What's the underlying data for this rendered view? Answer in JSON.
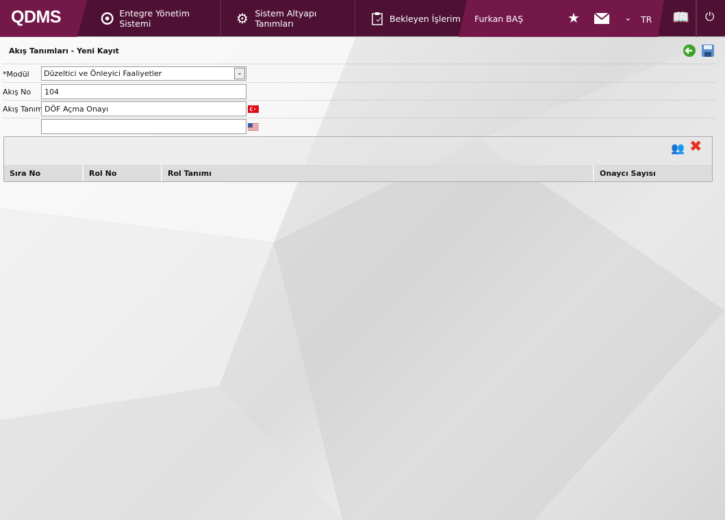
{
  "header": {
    "logo": "QDMS",
    "nav": [
      {
        "label": "Entegre Yönetim Sistemi",
        "icon": "q-icon"
      },
      {
        "label": "Sistem Altyapı Tanımları",
        "icon": "gear-icon"
      },
      {
        "label": "Bekleyen İşlerim",
        "icon": "clipboard-icon"
      }
    ],
    "user": "Furkan BAŞ",
    "lang": "TR"
  },
  "page": {
    "title": "Akış Tanımları - Yeni Kayıt"
  },
  "form": {
    "modul_label": "*Modül",
    "modul_value": "Düzeltici ve Önleyici Faaliyetler",
    "akis_no_label": "Akış No",
    "akis_no_value": "104",
    "akis_tanimi_label": "Akış Tanımı",
    "akis_tanimi_tr": "DÖF Açma Onayı",
    "akis_tanimi_en": ""
  },
  "table": {
    "columns": [
      "Sıra No",
      "Rol No",
      "Rol Tanımı",
      "Onaycı Sayısı"
    ]
  },
  "colors": {
    "header": "#4e1033",
    "accent": "#74184a"
  }
}
